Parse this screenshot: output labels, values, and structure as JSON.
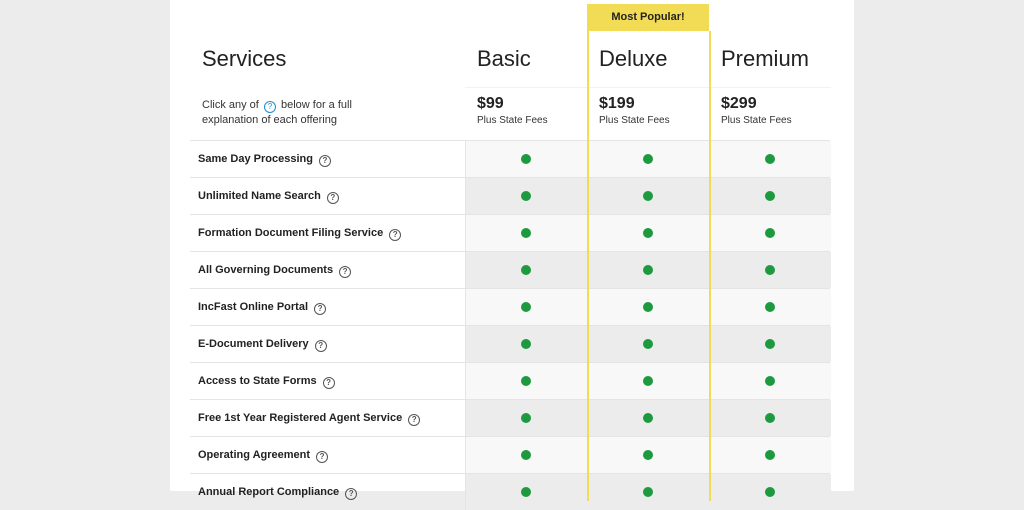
{
  "header": {
    "title": "Services",
    "hint_before": "Click any of",
    "hint_icon": "?",
    "hint_after": "below for a full explanation of each offering"
  },
  "badge": "Most Popular!",
  "plans": [
    {
      "name": "Basic",
      "price": "$99",
      "fees": "Plus State Fees"
    },
    {
      "name": "Deluxe",
      "price": "$199",
      "fees": "Plus State Fees"
    },
    {
      "name": "Premium",
      "price": "$299",
      "fees": "Plus State Fees"
    }
  ],
  "features": [
    {
      "label": "Same Day Processing",
      "icon": "?"
    },
    {
      "label": "Unlimited Name Search",
      "icon": "?"
    },
    {
      "label": "Formation Document Filing Service",
      "icon": "?"
    },
    {
      "label": "All Governing Documents",
      "icon": "?"
    },
    {
      "label": "IncFast Online Portal",
      "icon": "?"
    },
    {
      "label": "E-Document Delivery",
      "icon": "?"
    },
    {
      "label": "Access to State Forms",
      "icon": "?"
    },
    {
      "label": "Free 1st Year Registered Agent Service",
      "icon": "?"
    },
    {
      "label": "Operating Agreement",
      "icon": "?"
    },
    {
      "label": "Annual Report Compliance",
      "icon": "?"
    }
  ],
  "colors": {
    "included_dot": "#1d9a3f",
    "highlight": "#f2dc56"
  }
}
